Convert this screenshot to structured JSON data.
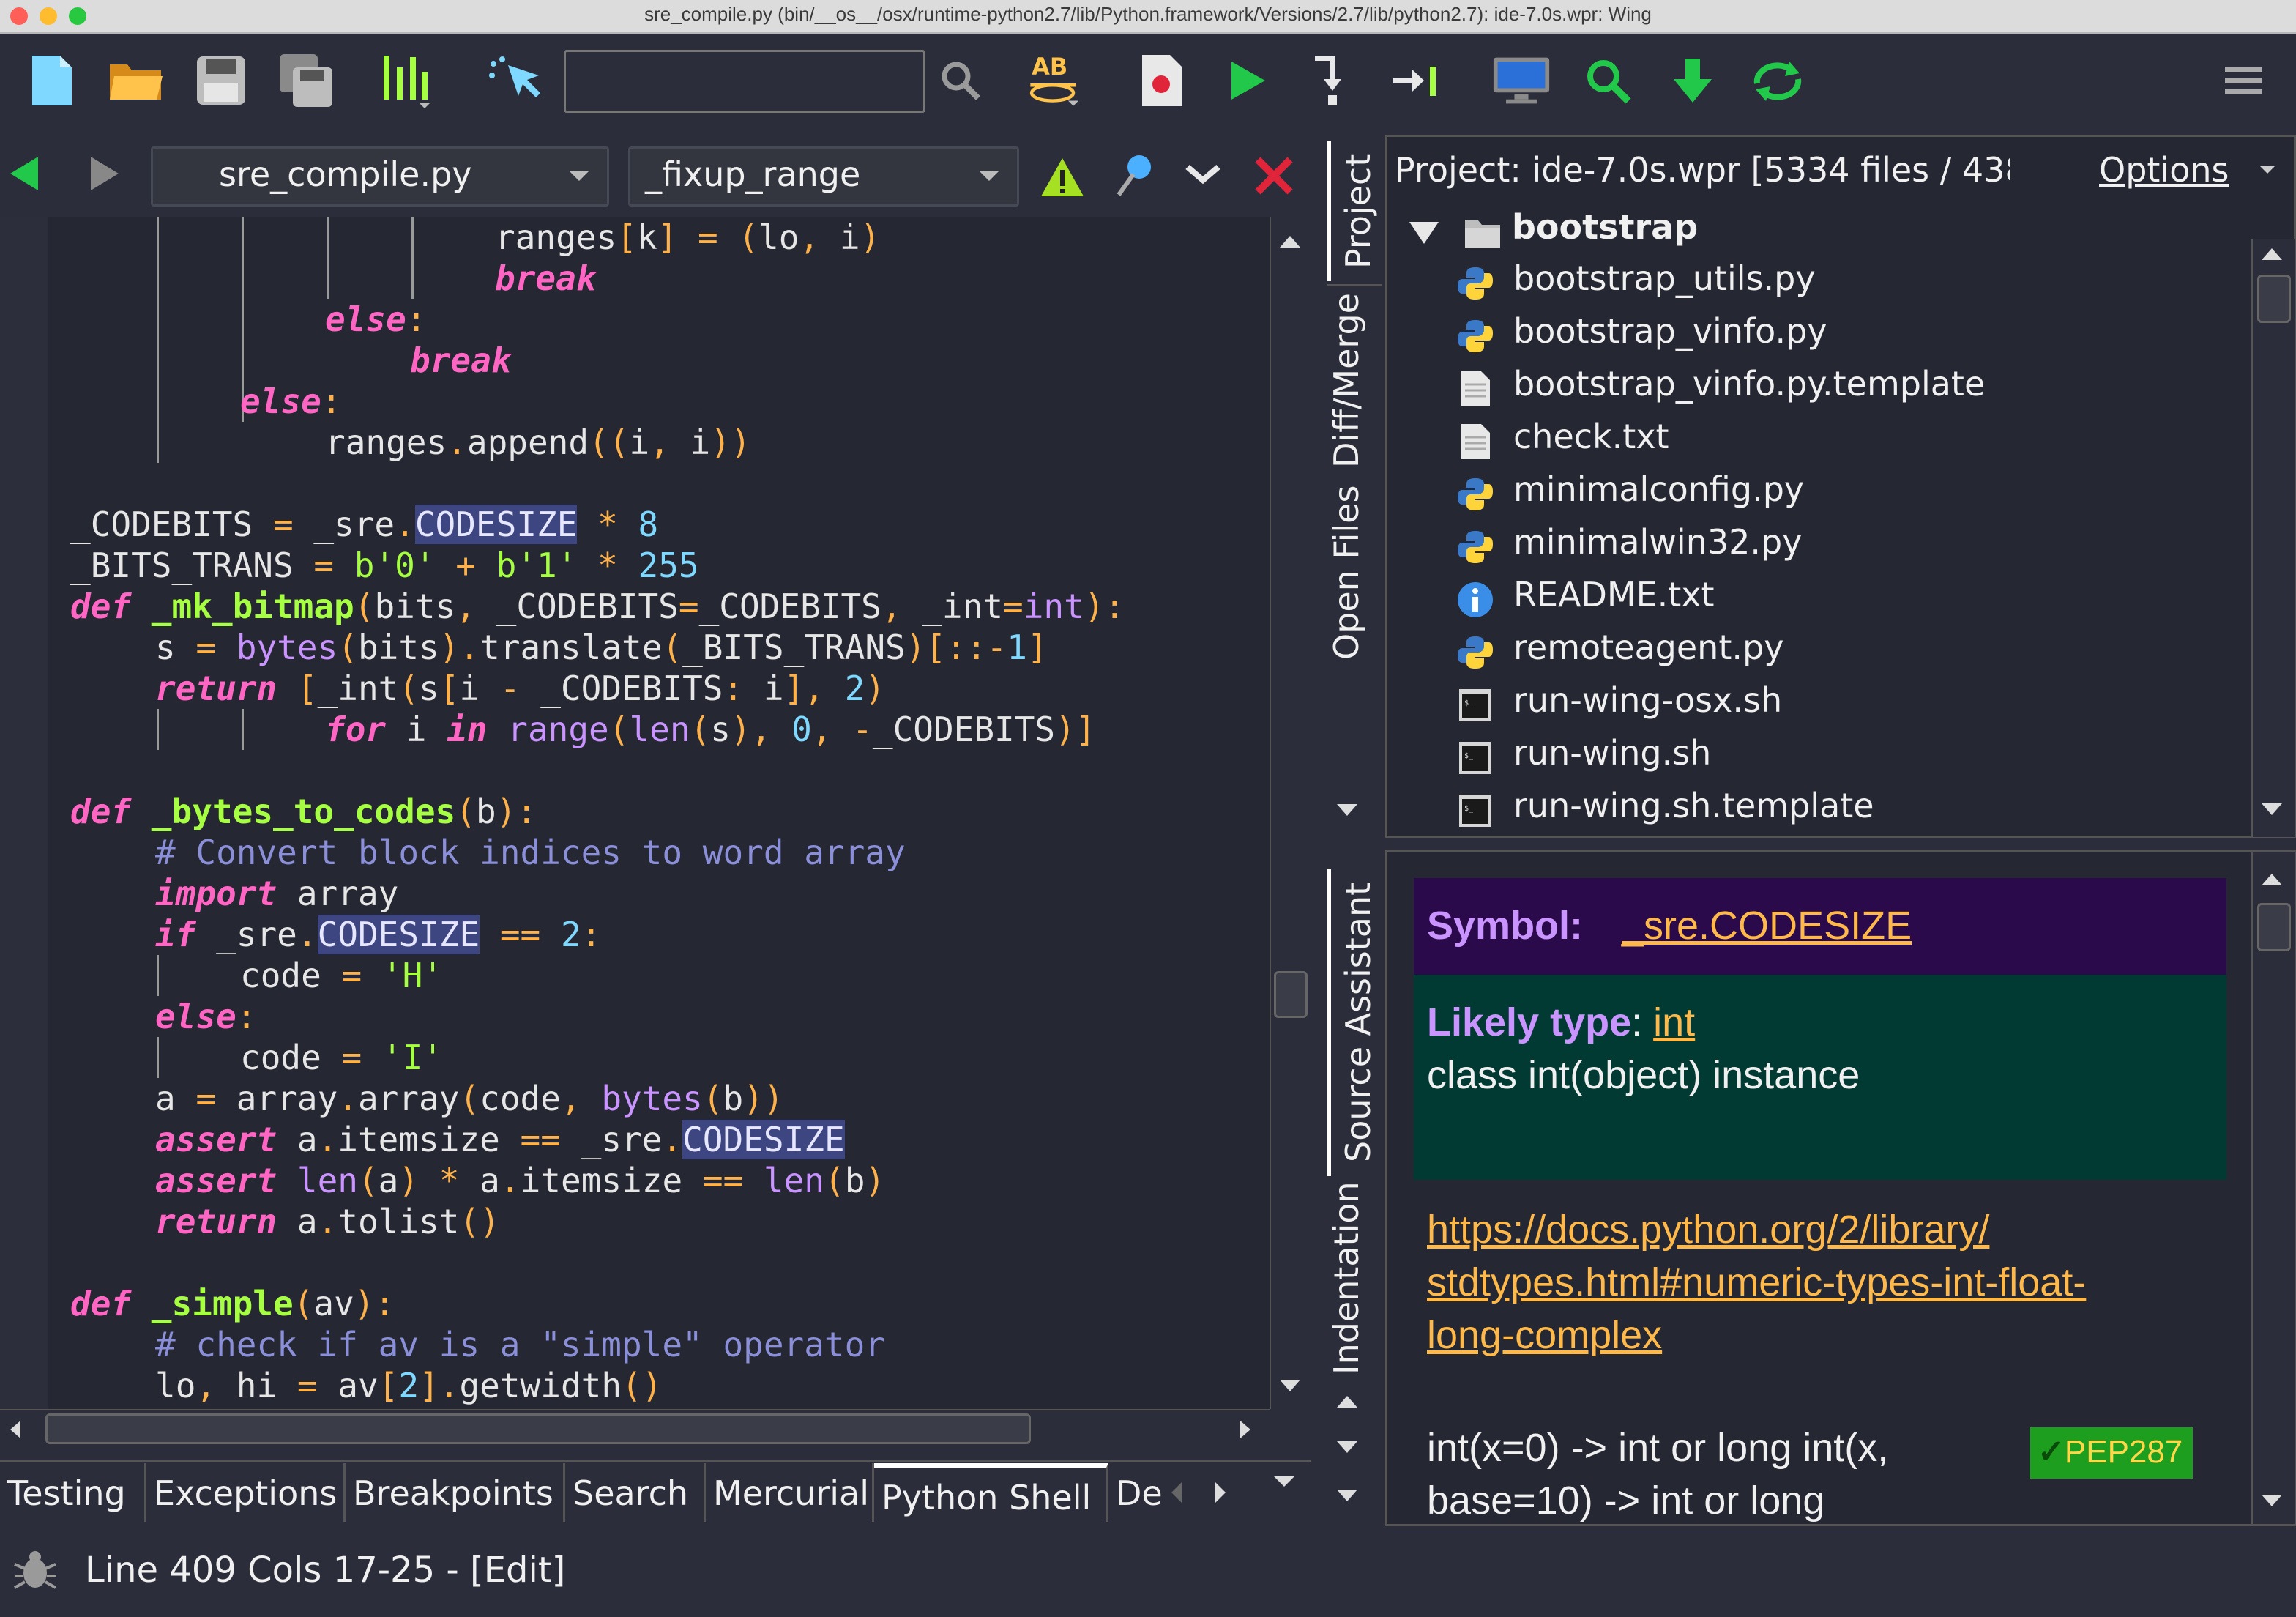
{
  "window": {
    "title": "sre_compile.py (bin/__os__/osx/runtime-python2.7/lib/Python.framework/Versions/2.7/lib/python2.7): ide-7.0s.wpr: Wing",
    "traffic_lights": [
      "#ff5f57",
      "#febc2e",
      "#28c840"
    ]
  },
  "toolbar": {
    "search_value": "",
    "icons": [
      "new-file-icon",
      "open-folder-icon",
      "save-icon",
      "save-all-icon",
      "indent-icon",
      "pointer-icon",
      "search-icon",
      "spell-check-icon",
      "debug-file-icon",
      "run-icon",
      "step-into-icon",
      "step-over-icon",
      "display-icon",
      "find-icon",
      "download-icon",
      "sync-icon",
      "menu-icon"
    ],
    "spell_label": "AB"
  },
  "editor": {
    "file_combo": "sre_compile.py",
    "scope_combo": "_fixup_range",
    "code_lines": [
      "ranges[k] = (lo, i)",
      "break",
      "else:",
      "break",
      "else:",
      "ranges.append((i, i))",
      "",
      "_CODEBITS = _sre.CODESIZE * 8",
      "_BITS_TRANS = b'0' + b'1' * 255",
      "def _mk_bitmap(bits, _CODEBITS=_CODEBITS, _int=int):",
      "s = bytes(bits).translate(_BITS_TRANS)[::-1]",
      "return [_int(s[i - _CODEBITS: i], 2)",
      "for i in range(len(s), 0, -_CODEBITS)]",
      "",
      "def _bytes_to_codes(b):",
      "# Convert block indices to word array",
      "import array",
      "if _sre.CODESIZE == 2:",
      "code = 'H'",
      "else:",
      "code = 'I'",
      "a = array.array(code, bytes(b))",
      "assert a.itemsize == _sre.CODESIZE",
      "assert len(a) * a.itemsize == len(b)",
      "return a.tolist()",
      "",
      "def _simple(av):",
      "# check if av is a \"simple\" operator",
      "lo, hi = av[2].getwidth()"
    ]
  },
  "bottom_tabs": [
    "Testing",
    "Exceptions",
    "Breakpoints",
    "Search",
    "Mercurial",
    "Python Shell",
    "De"
  ],
  "bottom_active": "Python Shell",
  "status": {
    "text": "Line 409 Cols 17-25 - [Edit]"
  },
  "side_tabs_top": [
    "Project",
    "Diff/Merge",
    "Open Files"
  ],
  "side_tabs_bottom": [
    "Source Assistant",
    "Indentation"
  ],
  "project": {
    "header": "Project: ide-7.0s.wpr [5334 files / 438",
    "options_label": "Options",
    "folder": "bootstrap",
    "files": [
      {
        "name": "bootstrap_utils.py",
        "icon": "python-file-icon"
      },
      {
        "name": "bootstrap_vinfo.py",
        "icon": "python-file-icon"
      },
      {
        "name": "bootstrap_vinfo.py.template",
        "icon": "text-file-icon"
      },
      {
        "name": "check.txt",
        "icon": "text-file-icon"
      },
      {
        "name": "minimalconfig.py",
        "icon": "python-file-icon"
      },
      {
        "name": "minimalwin32.py",
        "icon": "python-file-icon"
      },
      {
        "name": "README.txt",
        "icon": "info-file-icon"
      },
      {
        "name": "remoteagent.py",
        "icon": "python-file-icon"
      },
      {
        "name": "run-wing-osx.sh",
        "icon": "shell-file-icon"
      },
      {
        "name": "run-wing.sh",
        "icon": "shell-file-icon"
      },
      {
        "name": "run-wing.sh.template",
        "icon": "shell-file-icon"
      }
    ]
  },
  "source_assistant": {
    "symbol_label": "Symbol:",
    "symbol_value": "_sre.CODESIZE",
    "type_label": "Likely type",
    "type_value": "int",
    "type_desc": "class int(object) instance",
    "doc_link_1": "https://docs.python.org/2/library/",
    "doc_link_2": "stdtypes.html#numeric-types-int-float-",
    "doc_link_3": "long-complex",
    "sig_1": "int(x=0) -> int or long int(x,",
    "sig_2": "base=10) -> int or long",
    "pep_badge": "PEP287",
    "colors": {
      "symbol_bg": "#2a0a4a",
      "type_bg": "#003a33",
      "pep_bg": "#1e9e1e"
    }
  }
}
